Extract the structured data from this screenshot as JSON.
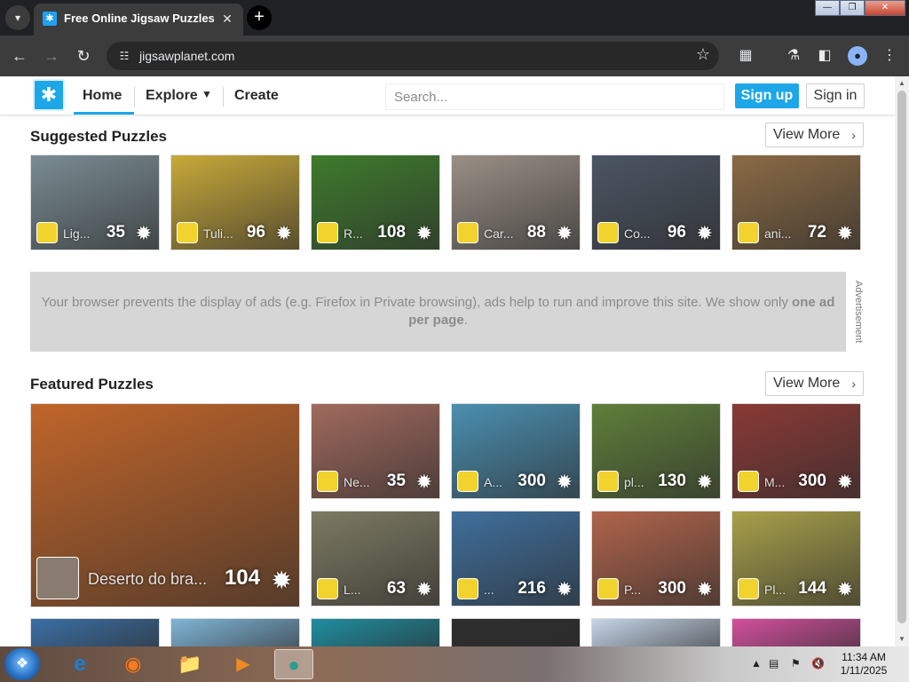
{
  "browser": {
    "tab_title": "Free Online Jigsaw Puzzles",
    "url": "jigsawplanet.com"
  },
  "header": {
    "nav": [
      "Home",
      "Explore",
      "Create"
    ],
    "search_placeholder": "Search...",
    "signup": "Sign up",
    "signin": "Sign in"
  },
  "suggested": {
    "title": "Suggested Puzzles",
    "view_more": "View More",
    "items": [
      {
        "title": "Lig...",
        "count": "35",
        "bg": "#7a8c93"
      },
      {
        "title": "Tuli...",
        "count": "96",
        "bg": "#c8a93a"
      },
      {
        "title": "R...",
        "count": "108",
        "bg": "#3e7b2c"
      },
      {
        "title": "Car...",
        "count": "88",
        "bg": "#9a8f86"
      },
      {
        "title": "Co...",
        "count": "96",
        "bg": "#4b5563"
      },
      {
        "title": "ani...",
        "count": "72",
        "bg": "#8b6b45"
      }
    ]
  },
  "ad": {
    "text": "Your browser prevents the display of ads (e.g. Firefox in Private browsing), ads help to run and improve this site. We show only",
    "bold": "one ad per page",
    "side_label": "Advertisement"
  },
  "featured": {
    "title": "Featured Puzzles",
    "view_more": "View More",
    "big": {
      "title": "Deserto do bra...",
      "count": "104",
      "bg": "#c0652a"
    },
    "items": [
      {
        "title": "Ne...",
        "count": "35",
        "bg": "#a16a5e"
      },
      {
        "title": "A...",
        "count": "300",
        "bg": "#4a8fb0"
      },
      {
        "title": "pl...",
        "count": "130",
        "bg": "#5f7f3a"
      },
      {
        "title": "M...",
        "count": "300",
        "bg": "#8a3a36"
      },
      {
        "title": "L...",
        "count": "63",
        "bg": "#7d7a62"
      },
      {
        "title": "...",
        "count": "216",
        "bg": "#3f6f9c"
      },
      {
        "title": "P...",
        "count": "300",
        "bg": "#b0644b"
      },
      {
        "title": "Pl...",
        "count": "144",
        "bg": "#a8a04a"
      }
    ],
    "row3_colors": [
      "#3b6fa5",
      "#7fb5d6",
      "#1f8ea0",
      "#2e2e2e",
      "#c6d5e8",
      "#d4509e"
    ]
  },
  "taskbar": {
    "time": "11:34 AM",
    "date": "1/11/2025"
  }
}
